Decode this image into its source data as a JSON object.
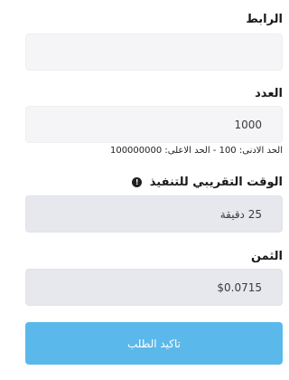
{
  "form": {
    "link": {
      "label": "الرابط",
      "value": "",
      "placeholder": ""
    },
    "quantity": {
      "label": "العدد",
      "value": "1000",
      "hint_min_label": "الحد الادنى:",
      "hint_min_value": "100",
      "hint_separator": "-",
      "hint_max_label": "الحد الاعلى:",
      "hint_max_value": "100000000"
    },
    "estimated_time": {
      "label": "الوقت التقريبي للتنفيذ",
      "info_icon": "info-icon",
      "value": "25 دقيقة"
    },
    "price": {
      "label": "الثمن",
      "value": "$0.0715"
    },
    "submit_label": "تاكيد الطلب"
  },
  "colors": {
    "accent": "#5bb8ea",
    "field_bg": "#f5f5f7",
    "readonly_bg": "#e7e8ed"
  }
}
